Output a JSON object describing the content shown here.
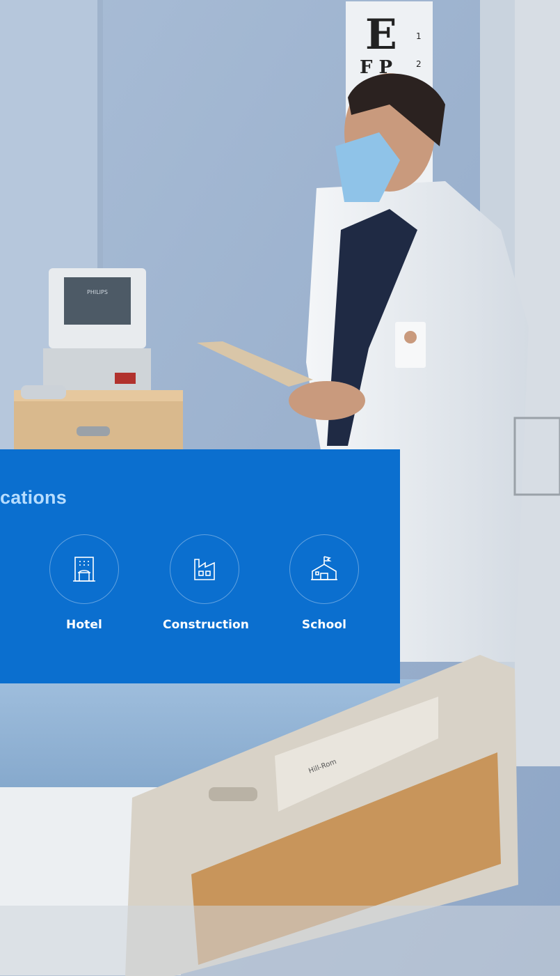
{
  "background": {
    "description_icon": "photo-doctor-hospital-room",
    "chart_text": {
      "letter_large": "E",
      "row2": "F P",
      "num1": "1",
      "num2": "2"
    },
    "monitor_brand": "PHILIPS",
    "bed_brand": "Hill-Rom"
  },
  "applications": {
    "title": "cations",
    "items": [
      {
        "label": "Hotel",
        "icon": "hotel-icon"
      },
      {
        "label": "Construction",
        "icon": "factory-icon"
      },
      {
        "label": "School",
        "icon": "school-icon"
      }
    ]
  },
  "colors": {
    "panel": "#0b6fcf",
    "title": "#b7ddff",
    "label": "#ffffff"
  }
}
